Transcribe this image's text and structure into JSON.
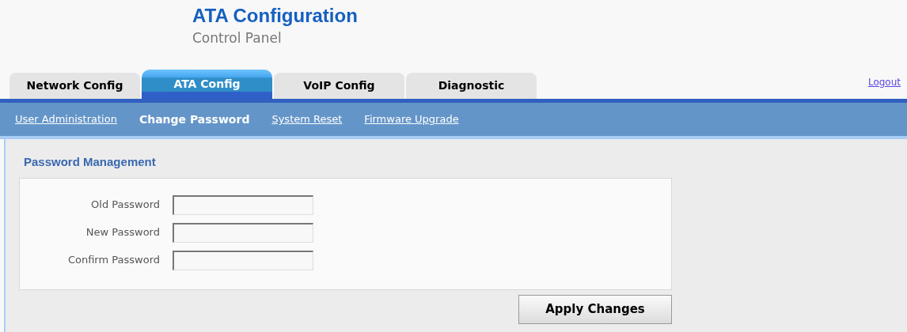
{
  "header": {
    "title": "ATA Configuration",
    "subtitle": "Control Panel"
  },
  "tabs": [
    {
      "label": "Network Config",
      "selected": false
    },
    {
      "label": "ATA Config",
      "selected": true
    },
    {
      "label": "VoIP Config",
      "selected": false
    },
    {
      "label": "Diagnostic",
      "selected": false
    }
  ],
  "logout": "Logout",
  "subnav": [
    {
      "label": "User Administration",
      "selected": false
    },
    {
      "label": "Change Password",
      "selected": true
    },
    {
      "label": "System Reset",
      "selected": false
    },
    {
      "label": "Firmware Upgrade",
      "selected": false
    }
  ],
  "section_title": "Password Management",
  "fields": [
    {
      "label": "Old Password"
    },
    {
      "label": "New Password"
    },
    {
      "label": "Confirm Password"
    }
  ],
  "apply_button": "Apply Changes"
}
